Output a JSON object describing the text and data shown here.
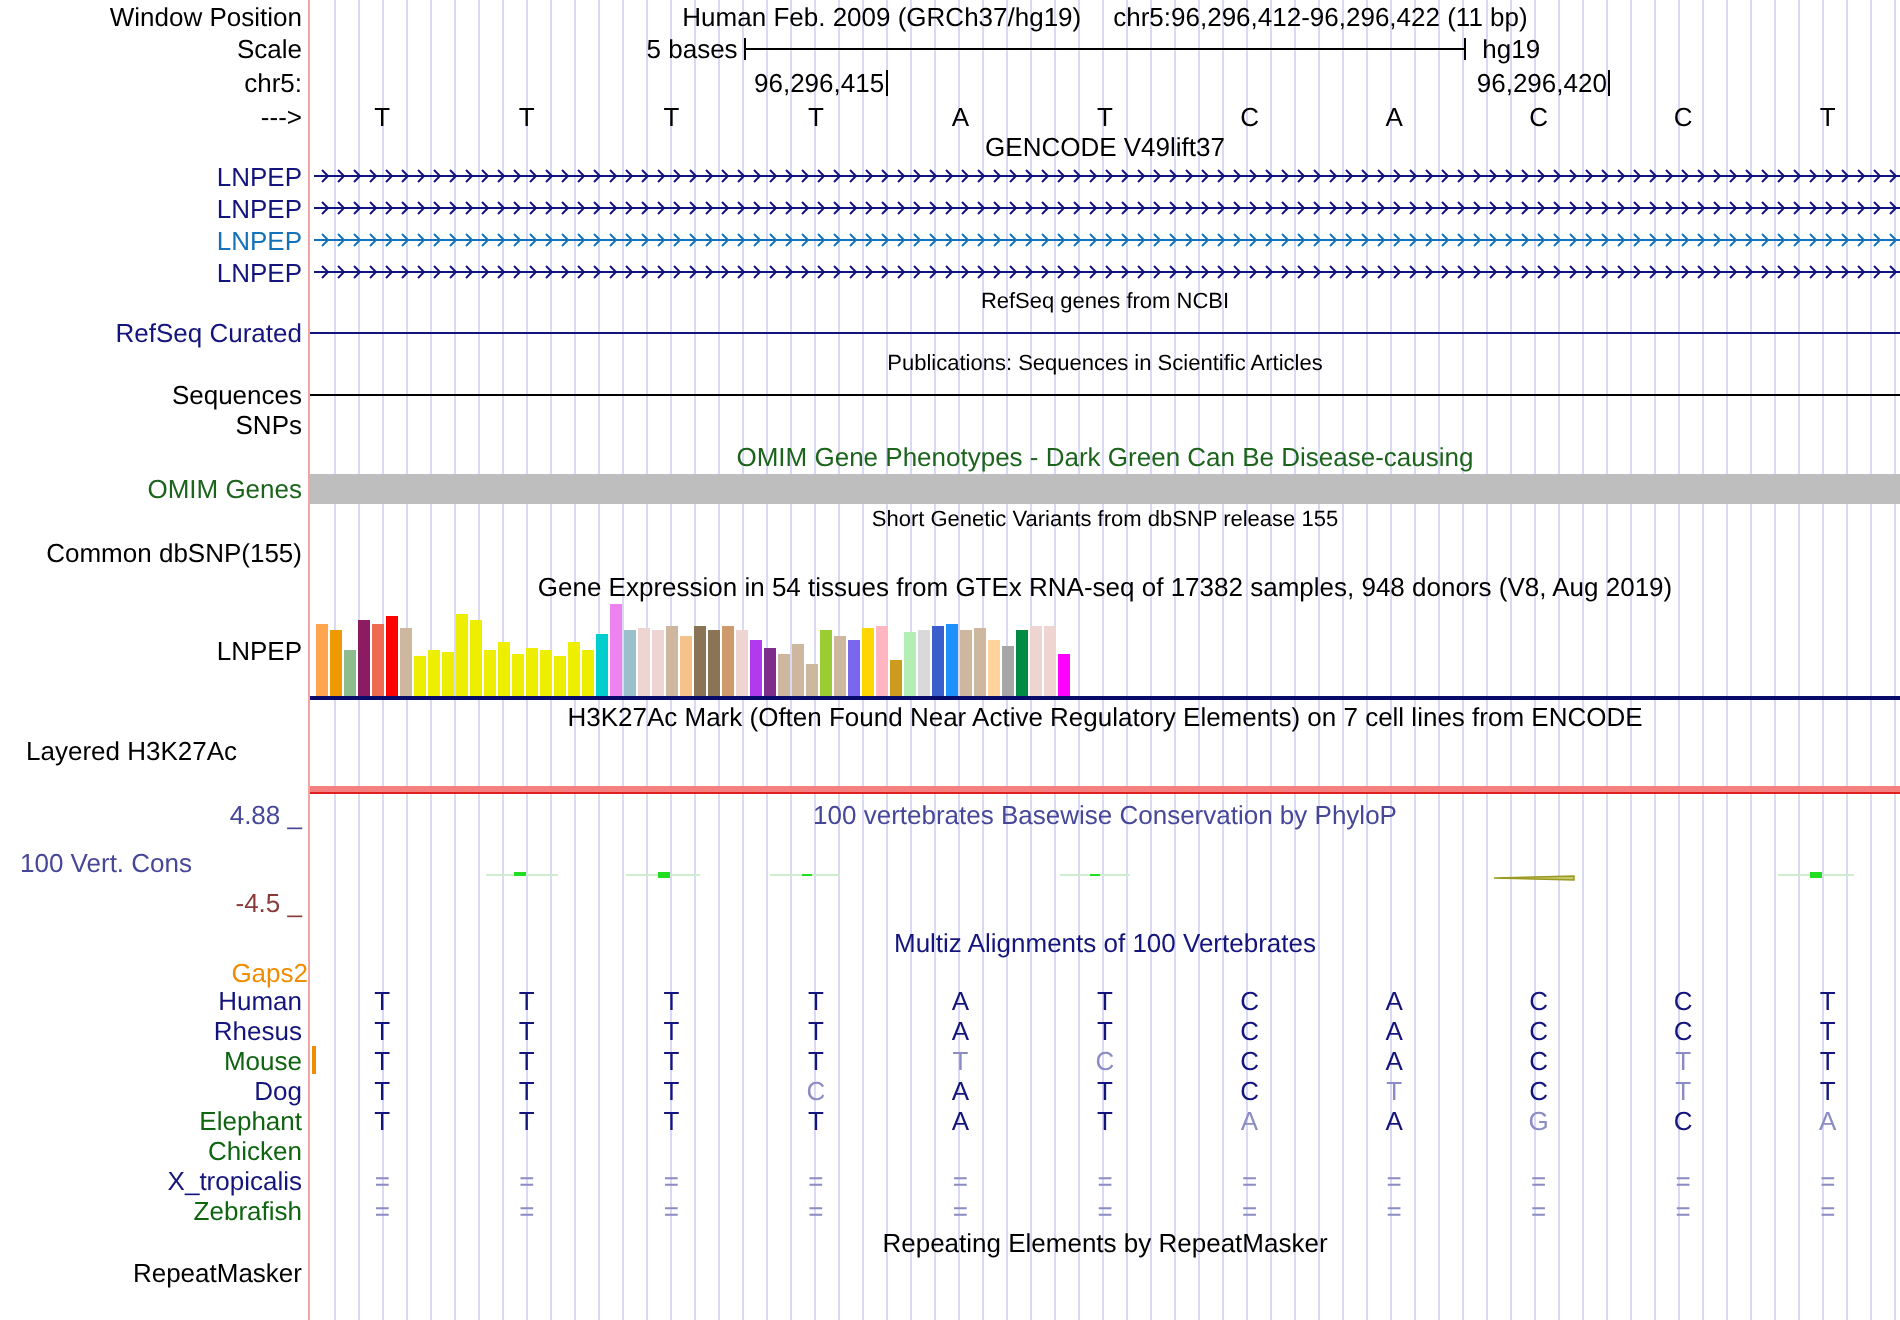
{
  "header": {
    "label": "Window Position",
    "assembly": "Human Feb. 2009 (GRCh37/hg19)",
    "position": "chr5:96,296,412-96,296,422 (11 bp)"
  },
  "scale": {
    "label": "Scale",
    "length": "5 bases",
    "assembly": "hg19"
  },
  "coordinates": {
    "label": "chr5:",
    "ticks": [
      "96,296,415",
      "96,296,420"
    ]
  },
  "sequence": {
    "label": "--->",
    "bases": [
      "T",
      "T",
      "T",
      "T",
      "A",
      "T",
      "C",
      "A",
      "C",
      "C",
      "T"
    ]
  },
  "gencode": {
    "title": "GENCODE V49lift37",
    "transcripts": [
      {
        "name": "LNPEP",
        "color": "#14147d"
      },
      {
        "name": "LNPEP",
        "color": "#14147d"
      },
      {
        "name": "LNPEP",
        "color": "#1473b8"
      },
      {
        "name": "LNPEP",
        "color": "#14147d"
      }
    ]
  },
  "refseq": {
    "title": "RefSeq genes from NCBI",
    "label": "RefSeq Curated"
  },
  "publications": {
    "title": "Publications: Sequences in Scientific Articles",
    "label": "Sequences"
  },
  "snps": {
    "label": "SNPs"
  },
  "omim": {
    "title": "OMIM Gene Phenotypes - Dark Green Can Be Disease-causing",
    "label": "OMIM Genes"
  },
  "dbsnp": {
    "title": "Short Genetic Variants from dbSNP release 155",
    "label": "Common dbSNP(155)"
  },
  "gtex": {
    "title": "Gene Expression in 54 tissues from GTEx RNA-seq of 17382 samples, 948 donors (V8, Aug 2019)",
    "label": "LNPEP"
  },
  "h3k27ac": {
    "title": "H3K27Ac Mark (Often Found Near Active Regulatory Elements) on 7 cell lines from ENCODE",
    "label": "Layered H3K27Ac"
  },
  "phylop": {
    "title": "100 vertebrates Basewise Conservation by PhyloP",
    "label": "100 Vert. Cons",
    "max": "4.88 _",
    "min": "-4.5 _"
  },
  "multiz": {
    "title": "Multiz Alignments of 100 Vertebrates",
    "gaps_label": "Gaps2",
    "species": [
      {
        "name": "Human",
        "color": "#14147d",
        "insertion": false,
        "kind": "bases",
        "bases": [
          {
            "base": "T",
            "mismatch": false
          },
          {
            "base": "T",
            "mismatch": false
          },
          {
            "base": "T",
            "mismatch": false
          },
          {
            "base": "T",
            "mismatch": false
          },
          {
            "base": "A",
            "mismatch": false
          },
          {
            "base": "T",
            "mismatch": false
          },
          {
            "base": "C",
            "mismatch": false
          },
          {
            "base": "A",
            "mismatch": false
          },
          {
            "base": "C",
            "mismatch": false
          },
          {
            "base": "C",
            "mismatch": false
          },
          {
            "base": "T",
            "mismatch": false
          }
        ]
      },
      {
        "name": "Rhesus",
        "color": "#14147d",
        "insertion": false,
        "kind": "bases",
        "bases": [
          {
            "base": "T",
            "mismatch": false
          },
          {
            "base": "T",
            "mismatch": false
          },
          {
            "base": "T",
            "mismatch": false
          },
          {
            "base": "T",
            "mismatch": false
          },
          {
            "base": "A",
            "mismatch": false
          },
          {
            "base": "T",
            "mismatch": false
          },
          {
            "base": "C",
            "mismatch": false
          },
          {
            "base": "A",
            "mismatch": false
          },
          {
            "base": "C",
            "mismatch": false
          },
          {
            "base": "C",
            "mismatch": false
          },
          {
            "base": "T",
            "mismatch": false
          }
        ]
      },
      {
        "name": "Mouse",
        "color": "#0f6410",
        "insertion": true,
        "kind": "bases",
        "bases": [
          {
            "base": "T",
            "mismatch": false
          },
          {
            "base": "T",
            "mismatch": false
          },
          {
            "base": "T",
            "mismatch": false
          },
          {
            "base": "T",
            "mismatch": false
          },
          {
            "base": "T",
            "mismatch": true
          },
          {
            "base": "C",
            "mismatch": true
          },
          {
            "base": "C",
            "mismatch": false
          },
          {
            "base": "A",
            "mismatch": false
          },
          {
            "base": "C",
            "mismatch": false
          },
          {
            "base": "T",
            "mismatch": true
          },
          {
            "base": "T",
            "mismatch": false
          }
        ]
      },
      {
        "name": "Dog",
        "color": "#14147d",
        "insertion": false,
        "kind": "bases",
        "bases": [
          {
            "base": "T",
            "mismatch": false
          },
          {
            "base": "T",
            "mismatch": false
          },
          {
            "base": "T",
            "mismatch": false
          },
          {
            "base": "C",
            "mismatch": true
          },
          {
            "base": "A",
            "mismatch": false
          },
          {
            "base": "T",
            "mismatch": false
          },
          {
            "base": "C",
            "mismatch": false
          },
          {
            "base": "T",
            "mismatch": true
          },
          {
            "base": "C",
            "mismatch": false
          },
          {
            "base": "T",
            "mismatch": true
          },
          {
            "base": "T",
            "mismatch": false
          }
        ]
      },
      {
        "name": "Elephant",
        "color": "#0f6410",
        "insertion": false,
        "kind": "bases",
        "bases": [
          {
            "base": "T",
            "mismatch": false
          },
          {
            "base": "T",
            "mismatch": false
          },
          {
            "base": "T",
            "mismatch": false
          },
          {
            "base": "T",
            "mismatch": false
          },
          {
            "base": "A",
            "mismatch": false
          },
          {
            "base": "T",
            "mismatch": false
          },
          {
            "base": "A",
            "mismatch": true
          },
          {
            "base": "A",
            "mismatch": false
          },
          {
            "base": "G",
            "mismatch": true
          },
          {
            "base": "C",
            "mismatch": false
          },
          {
            "base": "A",
            "mismatch": true
          }
        ]
      },
      {
        "name": "Chicken",
        "color": "#0f6410",
        "insertion": false,
        "kind": "empty"
      },
      {
        "name": "X_tropicalis",
        "color": "#14147d",
        "insertion": false,
        "kind": "gaps",
        "bases": [
          "=",
          "=",
          "=",
          "=",
          "=",
          "=",
          "=",
          "=",
          "=",
          "=",
          "="
        ]
      },
      {
        "name": "Zebrafish",
        "color": "#0f6410",
        "insertion": false,
        "kind": "gaps",
        "bases": [
          "=",
          "=",
          "=",
          "=",
          "=",
          "=",
          "=",
          "=",
          "=",
          "=",
          "="
        ]
      }
    ]
  },
  "repeatmasker": {
    "title": "Repeating Elements by RepeatMasker",
    "label": "RepeatMasker"
  }
}
